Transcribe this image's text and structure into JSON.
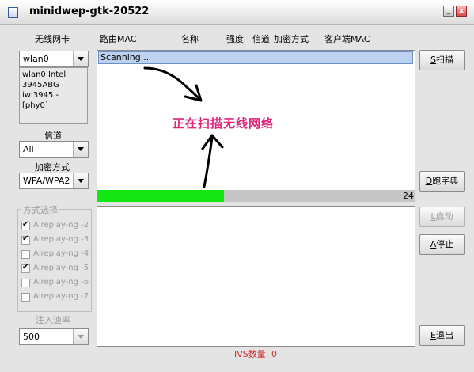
{
  "window": {
    "title": "minidwep-gtk-20522",
    "minimize": "_",
    "close": "x"
  },
  "left": {
    "card_label": "无线网卡",
    "card_value": "wlan0",
    "card_info": "wlan0 Intel 3945ABG iwl3945 - [phy0]",
    "channel_label": "信道",
    "channel_value": "All",
    "enc_label": "加密方式",
    "enc_value": "WPA/WPA2",
    "mode_label": "方式选择",
    "modes": [
      {
        "label": "Aireplay-ng -2",
        "checked": true
      },
      {
        "label": "Aireplay-ng -3",
        "checked": true
      },
      {
        "label": "Aireplay-ng -4",
        "checked": false
      },
      {
        "label": "Aireplay-ng -5",
        "checked": true
      },
      {
        "label": "Aireplay-ng -6",
        "checked": false
      },
      {
        "label": "Aireplay-ng -7",
        "checked": false
      }
    ],
    "rate_label": "注入速率",
    "rate_value": "500"
  },
  "table": {
    "headers": [
      "路由MAC",
      "名称",
      "强度",
      "信道",
      "加密方式",
      "客户端MAC"
    ],
    "row_text": "Scanning..."
  },
  "annotation": {
    "text": "正在扫描无线网络",
    "color": "#e0257a"
  },
  "progress": {
    "fraction": 0.4,
    "value_label": "24",
    "fill_color": "#14e614"
  },
  "buttons": {
    "scan": {
      "mnemonic": "S",
      "label": "扫描"
    },
    "dict": {
      "mnemonic": "D",
      "label": "跑字典"
    },
    "start": {
      "mnemonic": "L",
      "label": "启动"
    },
    "stop": {
      "mnemonic": "A",
      "label": "停止"
    },
    "quit": {
      "mnemonic": "E",
      "label": "退出"
    }
  },
  "status": {
    "ivs_text": "IVS数量: 0",
    "color": "#d22c2c"
  }
}
